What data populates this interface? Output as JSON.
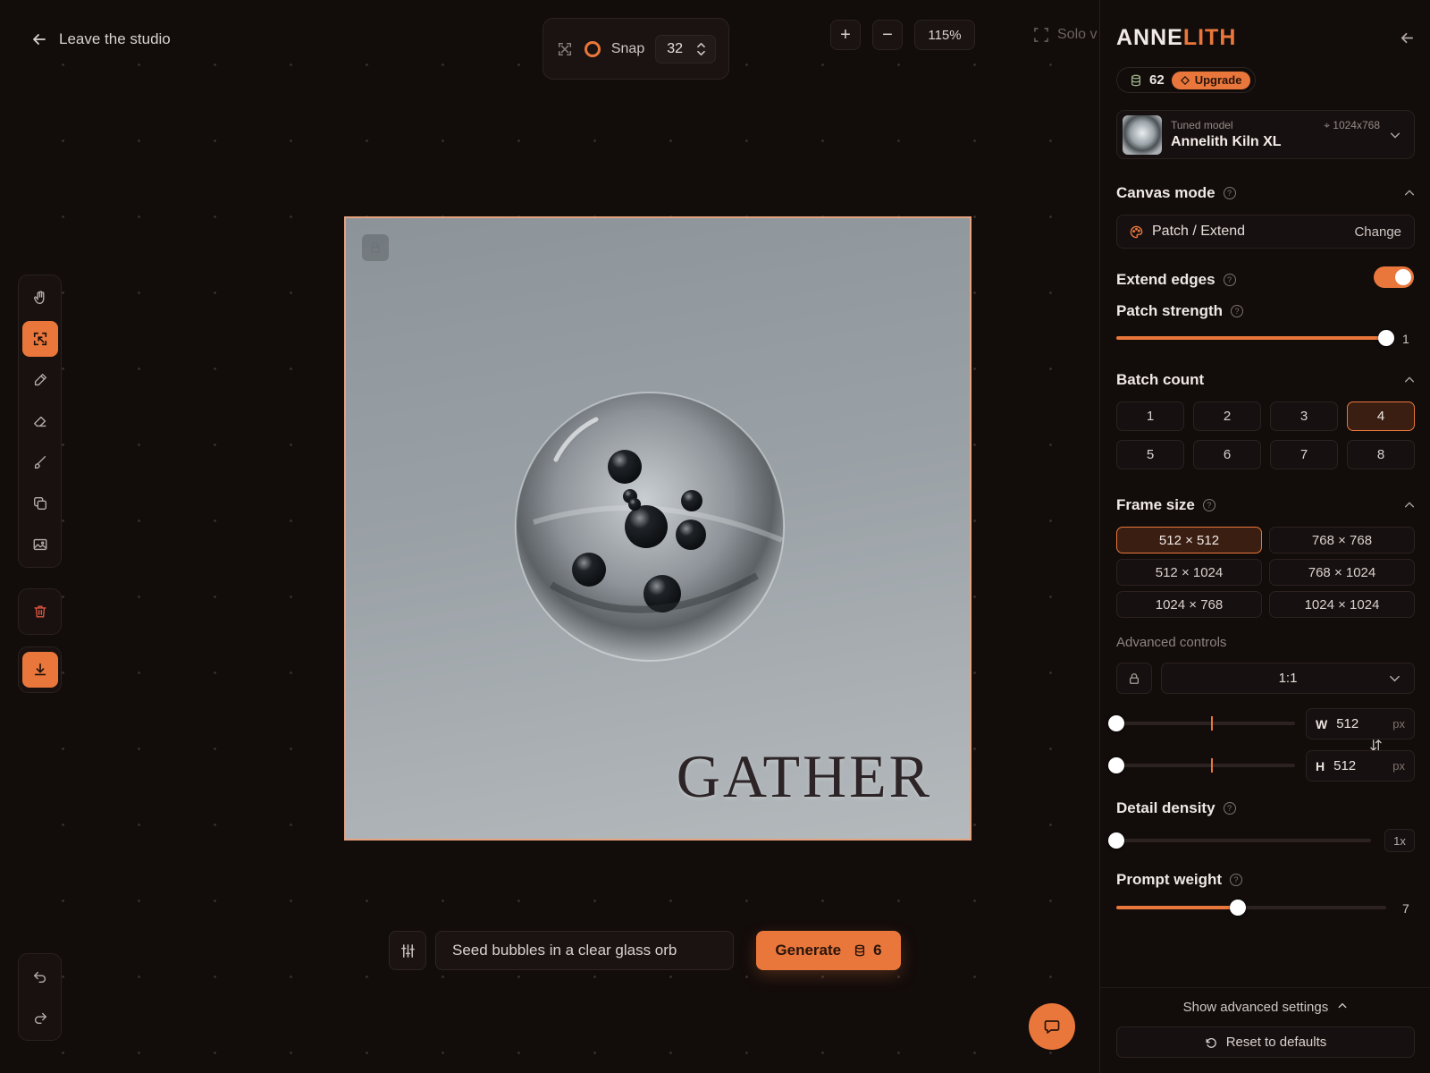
{
  "topbar": {
    "leave_label": "Leave the studio",
    "snap_label": "Snap",
    "snap_value": "32",
    "zoom_in_symbol": "+",
    "zoom_out_symbol": "−",
    "zoom_level": "115%",
    "solo_label": "Solo v"
  },
  "toolbar": {
    "tools": [
      {
        "name": "hand",
        "icon": "hand-icon"
      },
      {
        "name": "select",
        "icon": "select-frame-icon",
        "active": true
      },
      {
        "name": "pen",
        "icon": "pen-icon"
      },
      {
        "name": "eraser",
        "icon": "eraser-icon"
      },
      {
        "name": "brush",
        "icon": "brush-icon"
      },
      {
        "name": "duplicate",
        "icon": "copy-icon"
      },
      {
        "name": "image",
        "icon": "image-icon"
      }
    ],
    "delete_icon": "trash-icon",
    "download_icon": "download-icon",
    "undo_icon": "undo-icon",
    "redo_icon": "redo-icon"
  },
  "canvas": {
    "image_text": "GATHER",
    "lock_icon": "lock-icon"
  },
  "prompt": {
    "value": "Seed bubbles in a clear glass orb",
    "generate_label": "Generate",
    "generate_cost": "6"
  },
  "panel": {
    "brand_first": "ANNE",
    "brand_second": "LITH",
    "credits": "62",
    "upgrade_label": "Upgrade",
    "model": {
      "caption": "Tuned model",
      "name": "Annelith Kiln XL",
      "resolution": "1024x768"
    },
    "canvas_mode": {
      "title": "Canvas mode",
      "value": "Patch / Extend",
      "change_label": "Change"
    },
    "extend_edges": {
      "title": "Extend edges",
      "enabled": true
    },
    "patch_strength": {
      "title": "Patch strength",
      "value": "1",
      "fraction": 1.0
    },
    "batch_count": {
      "title": "Batch count",
      "options": [
        "1",
        "2",
        "3",
        "4",
        "5",
        "6",
        "7",
        "8"
      ],
      "selected": "4"
    },
    "frame_size": {
      "title": "Frame size",
      "options": [
        "512 × 512",
        "768 × 768",
        "512 × 1024",
        "768 × 1024",
        "1024 × 768",
        "1024 × 1024"
      ],
      "selected": "512 × 512"
    },
    "advanced": {
      "label": "Advanced controls",
      "ratio": "1:1",
      "width_label": "W",
      "width": "512",
      "height_label": "H",
      "height": "512",
      "unit": "px"
    },
    "detail_density": {
      "title": "Detail density",
      "value": "1x",
      "fraction": 0.0
    },
    "prompt_weight": {
      "title": "Prompt weight",
      "value": "7",
      "fraction": 0.45
    },
    "show_advanced_label": "Show advanced settings",
    "reset_label": "Reset to defaults"
  },
  "colors": {
    "accent": "#e9773b",
    "background": "#120c0b",
    "frame_border": "#e6a37f"
  }
}
